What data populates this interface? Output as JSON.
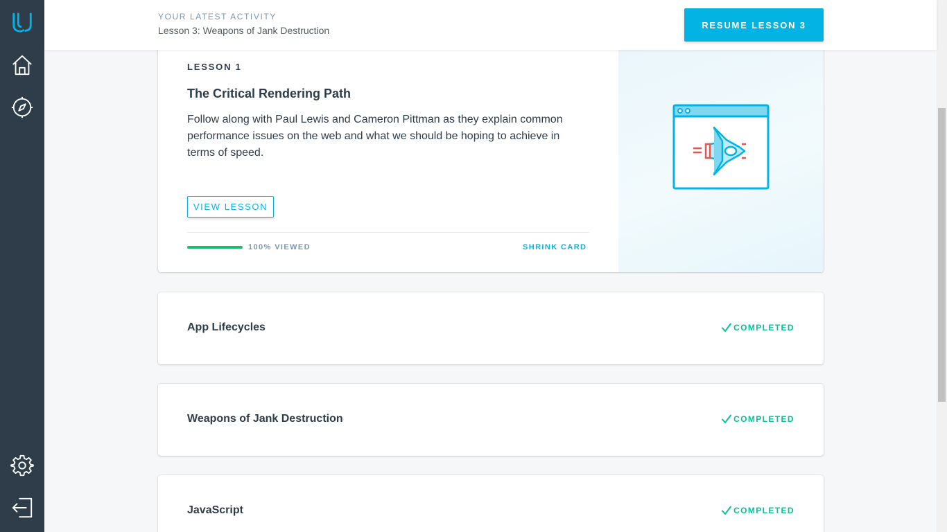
{
  "sidebar": {
    "logo_icon": "udacity-logo-icon",
    "items": [
      {
        "icon": "home-icon"
      },
      {
        "icon": "compass-icon"
      },
      {
        "icon": "gear-icon"
      },
      {
        "icon": "logout-icon"
      }
    ]
  },
  "header": {
    "activity_label": "YOUR LATEST ACTIVITY",
    "activity_lesson": "Lesson 3: Weapons of Jank Destruction",
    "resume_label": "RESUME LESSON 3"
  },
  "expanded_lesson": {
    "number_label": "LESSON 1",
    "title": "The Critical Rendering Path",
    "description": "Follow along with Paul Lewis and Cameron Pittman as they explain common performance issues on the web and what we should be hoping to achieve in terms of speed.",
    "view_label": "VIEW LESSON",
    "progress_percent": 100,
    "progress_text": "100% VIEWED",
    "shrink_label": "SHRINK CARD",
    "art_icon": "browser-rocket-icon"
  },
  "lessons": [
    {
      "title": "App Lifecycles",
      "status": "COMPLETED"
    },
    {
      "title": "Weapons of Jank Destruction",
      "status": "COMPLETED"
    },
    {
      "title": "JavaScript",
      "status": "COMPLETED"
    }
  ],
  "colors": {
    "sidebar": "#2e3d49",
    "accent": "#02b3e4",
    "progress": "#15c26b",
    "completed": "#02c39a"
  }
}
